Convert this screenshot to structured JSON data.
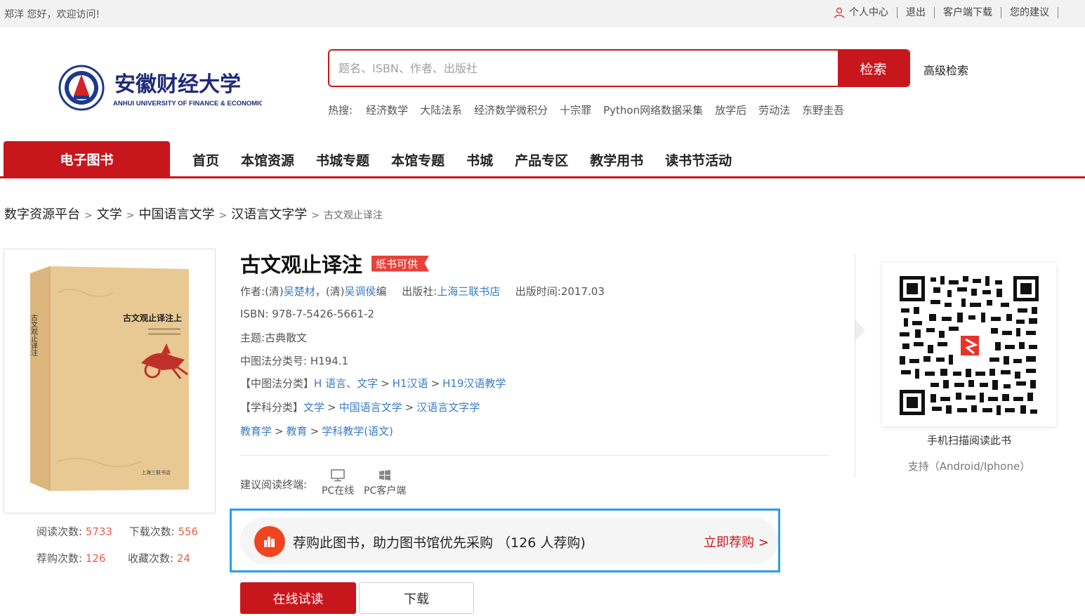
{
  "topbar": {
    "greeting": "郑洋 您好，欢迎访问!",
    "links": [
      "个人中心",
      "退出",
      "客户端下载",
      "您的建议"
    ]
  },
  "header": {
    "logo_text_cn": "安徽财经大学",
    "logo_text_en": "ANHUI UNIVERSITY OF FINANCE & ECONOMICS",
    "search_placeholder": "题名、ISBN、作者、出版社",
    "search_button": "检索",
    "advanced_search": "高级检索",
    "hot_label": "热搜:",
    "hot_keywords": [
      "经济数学",
      "大陆法系",
      "经济数学微积分",
      "十宗罪",
      "Python网络数据采集",
      "放学后",
      "劳动法",
      "东野圭吾"
    ]
  },
  "nav": {
    "active_tab": "电子图书",
    "items": [
      "首页",
      "本馆资源",
      "书城专题",
      "本馆专题",
      "书城",
      "产品专区",
      "教学用书",
      "读书节活动"
    ]
  },
  "breadcrumb": [
    "数字资源平台",
    "文学",
    "中国语言文学",
    "汉语言文字学",
    "古文观止译注"
  ],
  "book": {
    "title": "古文观止译注",
    "tag": "纸书可供",
    "author_label": "作者:",
    "author_prefix_1": "(清)",
    "author_1": "吴楚材",
    "author_sep": "，",
    "author_prefix_2": "(清)",
    "author_2": "吴调侯",
    "author_suffix": "编",
    "publisher_label": "出版社:",
    "publisher": "上海三联书店",
    "pubdate_label": "出版时间:",
    "pubdate": "2017.03",
    "isbn_label": "ISBN:",
    "isbn": "978-7-5426-5661-2",
    "subject_label": "主题:",
    "subject": "古典散文",
    "clc_label": "中图法分类号:",
    "clc": "H194.1",
    "clc_class_label": "【中图法分类】",
    "clc_path": [
      "H 语言、文字",
      "H1汉语",
      "H19汉语教学"
    ],
    "discipline_label": "【学科分类】",
    "discipline_path_1": [
      "文学",
      "中国语言文学",
      "汉语言文字学"
    ],
    "discipline_path_2": [
      "教育学",
      "教育",
      "学科教学(语文)"
    ],
    "cover_title": "古文观止译注上",
    "cover_publisher": "上海三联书店"
  },
  "stats": {
    "read_label": "阅读次数:",
    "read": "5733",
    "download_label": "下载次数:",
    "download": "556",
    "recommend_label": "荐购次数:",
    "recommend": "126",
    "favorite_label": "收藏次数:",
    "favorite": "24"
  },
  "terminal": {
    "label": "建议阅读终端:",
    "pc_online": "PC在线",
    "pc_client": "PC客户端"
  },
  "recommend": {
    "text": "荐购此图书，助力图书馆优先采购 （126 人荐购)",
    "action": "立即荐购 >"
  },
  "buttons": {
    "read_online": "在线试读",
    "download": "下载"
  },
  "qr": {
    "caption": "手机扫描阅读此书",
    "support": "支持（Android/Iphone）"
  },
  "colors": {
    "brand_red": "#c8161d",
    "link_blue": "#3a7cc5",
    "stat_orange": "#e8614a",
    "highlight_blue": "#2d9cf0"
  }
}
